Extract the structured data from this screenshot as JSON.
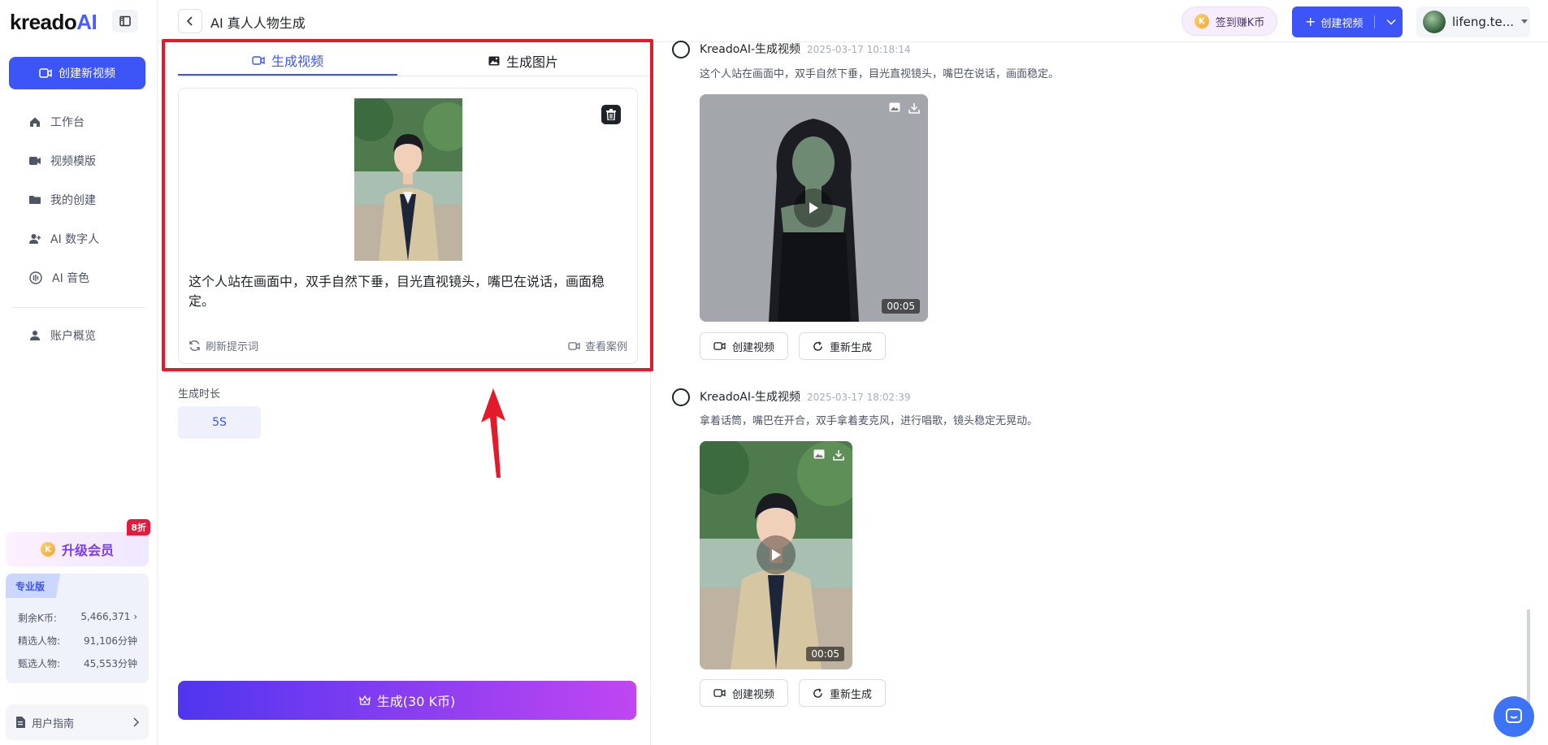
{
  "logo": {
    "text_a": "kreado",
    "text_b": "AI"
  },
  "sidebar": {
    "create_button": "创建新视频",
    "items": [
      {
        "label": "工作台",
        "icon": "home-icon"
      },
      {
        "label": "视频模版",
        "icon": "video-camera-icon"
      },
      {
        "label": "我的创建",
        "icon": "folder-icon"
      },
      {
        "label": "AI 数字人",
        "icon": "user-plus-icon"
      },
      {
        "label": "AI 音色",
        "icon": "sound-wave-icon"
      }
    ],
    "account_item": {
      "label": "账户概览",
      "icon": "user-icon"
    },
    "promo": {
      "label": "升级会员",
      "badge": "8折"
    },
    "plan": {
      "tag": "专业版",
      "rows": [
        {
          "label": "剩余K币:",
          "value": "5,466,371 ›"
        },
        {
          "label": "精选人物:",
          "value": "91,106分钟"
        },
        {
          "label": "甄选人物:",
          "value": "45,553分钟"
        }
      ]
    },
    "guide": {
      "label": "用户指南"
    }
  },
  "topbar": {
    "title": "AI 真人人物生成",
    "coin_pill": "签到赚K币",
    "create_video": "创建视频",
    "user": "lifeng.te..."
  },
  "panel": {
    "tabs": [
      {
        "label": "生成视频",
        "active": true
      },
      {
        "label": "生成图片",
        "active": false
      }
    ],
    "prompt": "这个人站在画面中，双手自然下垂，目光直视镜头，嘴巴在说话，画面稳定。",
    "refresh_label": "刷新提示词",
    "case_label": "查看案例",
    "duration_label": "生成时长",
    "duration_value": "5S",
    "generate_button": "生成(30 K币)"
  },
  "feed": [
    {
      "source": "KreadoAI-生成视频",
      "time": "2025-03-17 10:18:14",
      "prompt": "这个人站在画面中，双手自然下垂，目光直视镜头，嘴巴在说话，画面稳定。",
      "duration": "00:05",
      "create_label": "创建视频",
      "regen_label": "重新生成"
    },
    {
      "source": "KreadoAI-生成视频",
      "time": "2025-03-17 18:02:39",
      "prompt": "拿着话筒，嘴巴在开合，双手拿着麦克风，进行唱歌，镜头稳定无晃动。",
      "duration": "00:05",
      "create_label": "创建视频",
      "regen_label": "重新生成"
    }
  ],
  "colors": {
    "accent": "#3d55f6",
    "highlight": "#e21a2a",
    "gradient_start": "#4f35ef",
    "gradient_end": "#c146f2"
  }
}
